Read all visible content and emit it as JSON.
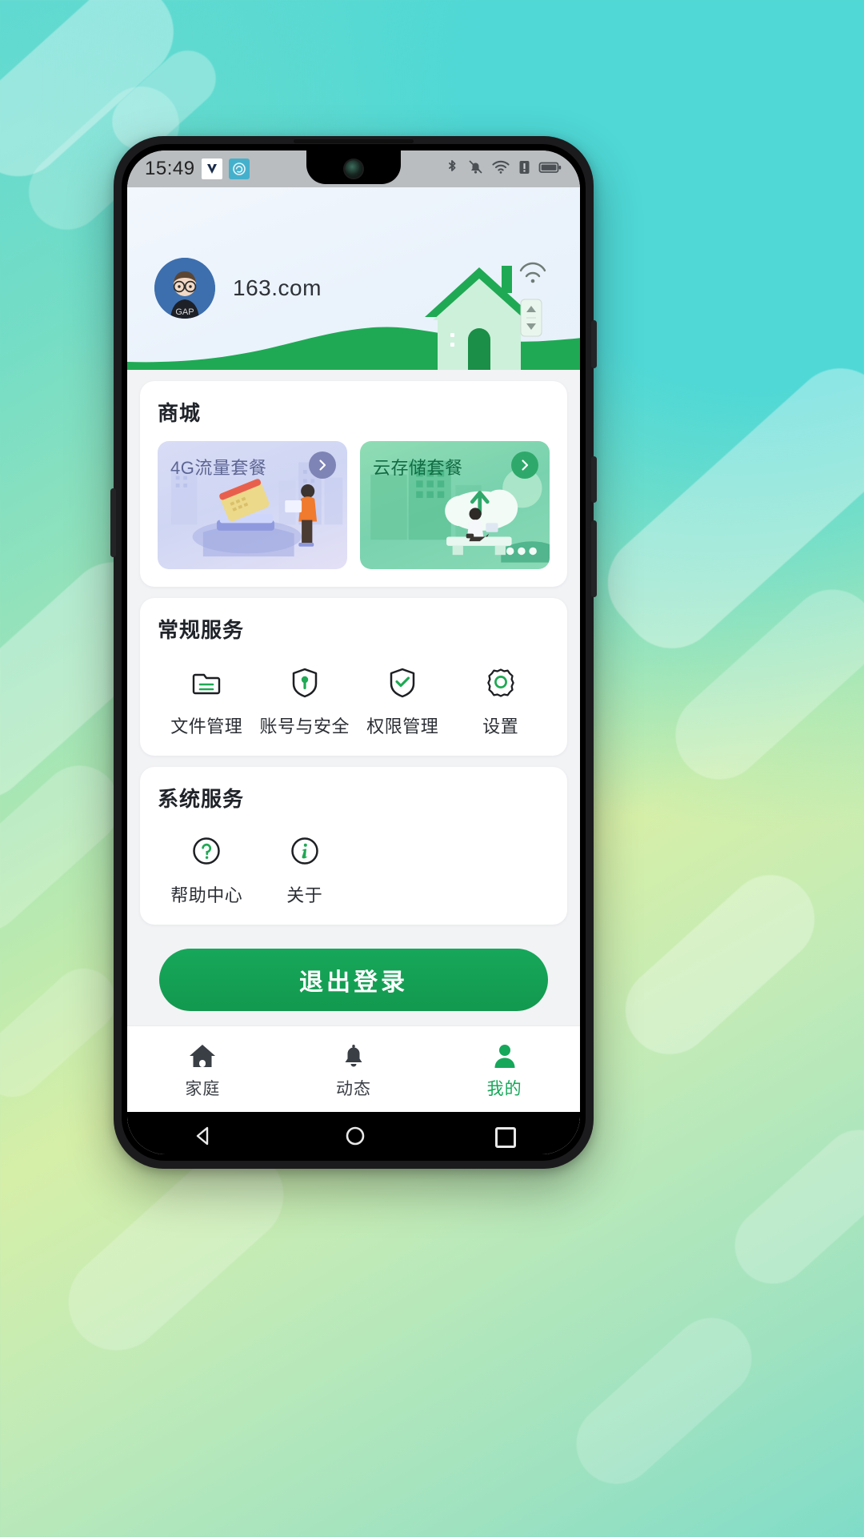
{
  "status_bar": {
    "time": "15:49",
    "left_icons": [
      "v-app-icon",
      "cloud-sync-icon"
    ],
    "right_icons": [
      "bluetooth-icon",
      "mute-bell-icon",
      "wifi-icon",
      "sim-alert-icon",
      "battery-icon"
    ]
  },
  "header": {
    "username": "163.com",
    "avatar_label": "GAP",
    "illustration": "green-house-with-wifi-illustration"
  },
  "mall": {
    "title": "商城",
    "items": [
      {
        "label": "4G流量套餐",
        "accent": "#7e84b5",
        "arrow_icon": "chevron-right-icon"
      },
      {
        "label": "云存储套餐",
        "accent": "#2fa96b",
        "arrow_icon": "chevron-right-icon"
      }
    ]
  },
  "general_services": {
    "title": "常规服务",
    "items": [
      {
        "label": "文件管理",
        "icon": "folder-icon"
      },
      {
        "label": "账号与安全",
        "icon": "shield-key-icon"
      },
      {
        "label": "权限管理",
        "icon": "shield-check-icon"
      },
      {
        "label": "设置",
        "icon": "gear-icon"
      }
    ]
  },
  "system_services": {
    "title": "系统服务",
    "items": [
      {
        "label": "帮助中心",
        "icon": "question-circle-icon"
      },
      {
        "label": "关于",
        "icon": "info-circle-icon"
      }
    ]
  },
  "logout": {
    "label": "退出登录",
    "color": "#17a75a"
  },
  "tabbar": {
    "tabs": [
      {
        "label": "家庭",
        "icon": "home-icon",
        "active": "false"
      },
      {
        "label": "动态",
        "icon": "bell-icon",
        "active": "false"
      },
      {
        "label": "我的",
        "icon": "person-icon",
        "active": "true"
      }
    ]
  },
  "nav_bar": {
    "back": "triangle-back-icon",
    "home": "circle-home-icon",
    "recents": "square-recents-icon"
  }
}
